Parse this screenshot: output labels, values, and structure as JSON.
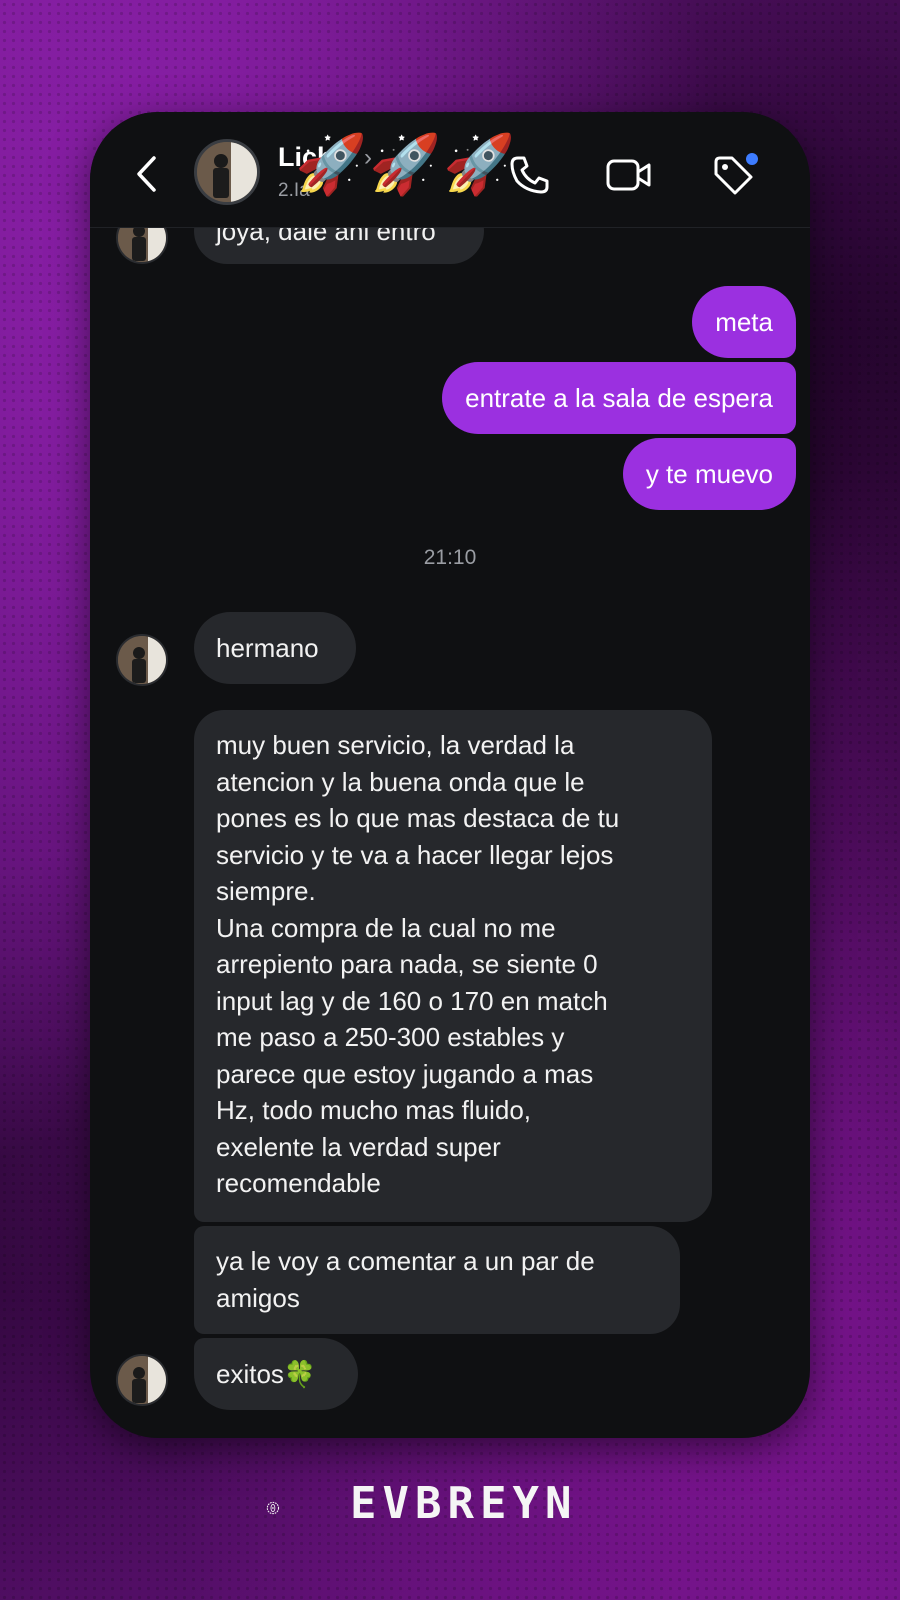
{
  "header": {
    "contact_name": "Lich",
    "subtitle": "2.Ia",
    "title_emoji": "🚀🚀🚀"
  },
  "messages": [
    {
      "side": "in",
      "text": "joya, dale ahi entro"
    },
    {
      "side": "out",
      "text": "meta"
    },
    {
      "side": "out",
      "text": "entrate a la sala de espera"
    },
    {
      "side": "out",
      "text": "y te muevo"
    },
    {
      "side": "in",
      "text": "hermano"
    },
    {
      "side": "in",
      "text": "muy buen servicio, la verdad la\natencion y la buena onda que le\npones es lo que mas destaca de tu\nservicio y te va a hacer llegar lejos\nsiempre.\nUna compra de la cual no me\narrepiento para nada, se siente 0\ninput lag y de 160 o 170 en match\nme paso a 250-300 estables y\nparece que estoy jugando a mas\nHz, todo mucho mas fluido,\nexelente la verdad super\nrecomendable"
    },
    {
      "side": "in",
      "text": "ya le voy a comentar a un par de\namigos"
    },
    {
      "side": "in",
      "text": "exitos🍀"
    }
  ],
  "timestamp": "21:10",
  "brand": {
    "name": "EVBREYN"
  },
  "colors": {
    "outgoing_bubble": "#9b30e0",
    "incoming_bubble": "#26282c",
    "background_purple": "#7b1b96"
  },
  "icons": [
    "back-arrow-icon",
    "phone-icon",
    "video-camera-icon",
    "tag-icon",
    "clover-emoji",
    "rocket-emoji"
  ]
}
